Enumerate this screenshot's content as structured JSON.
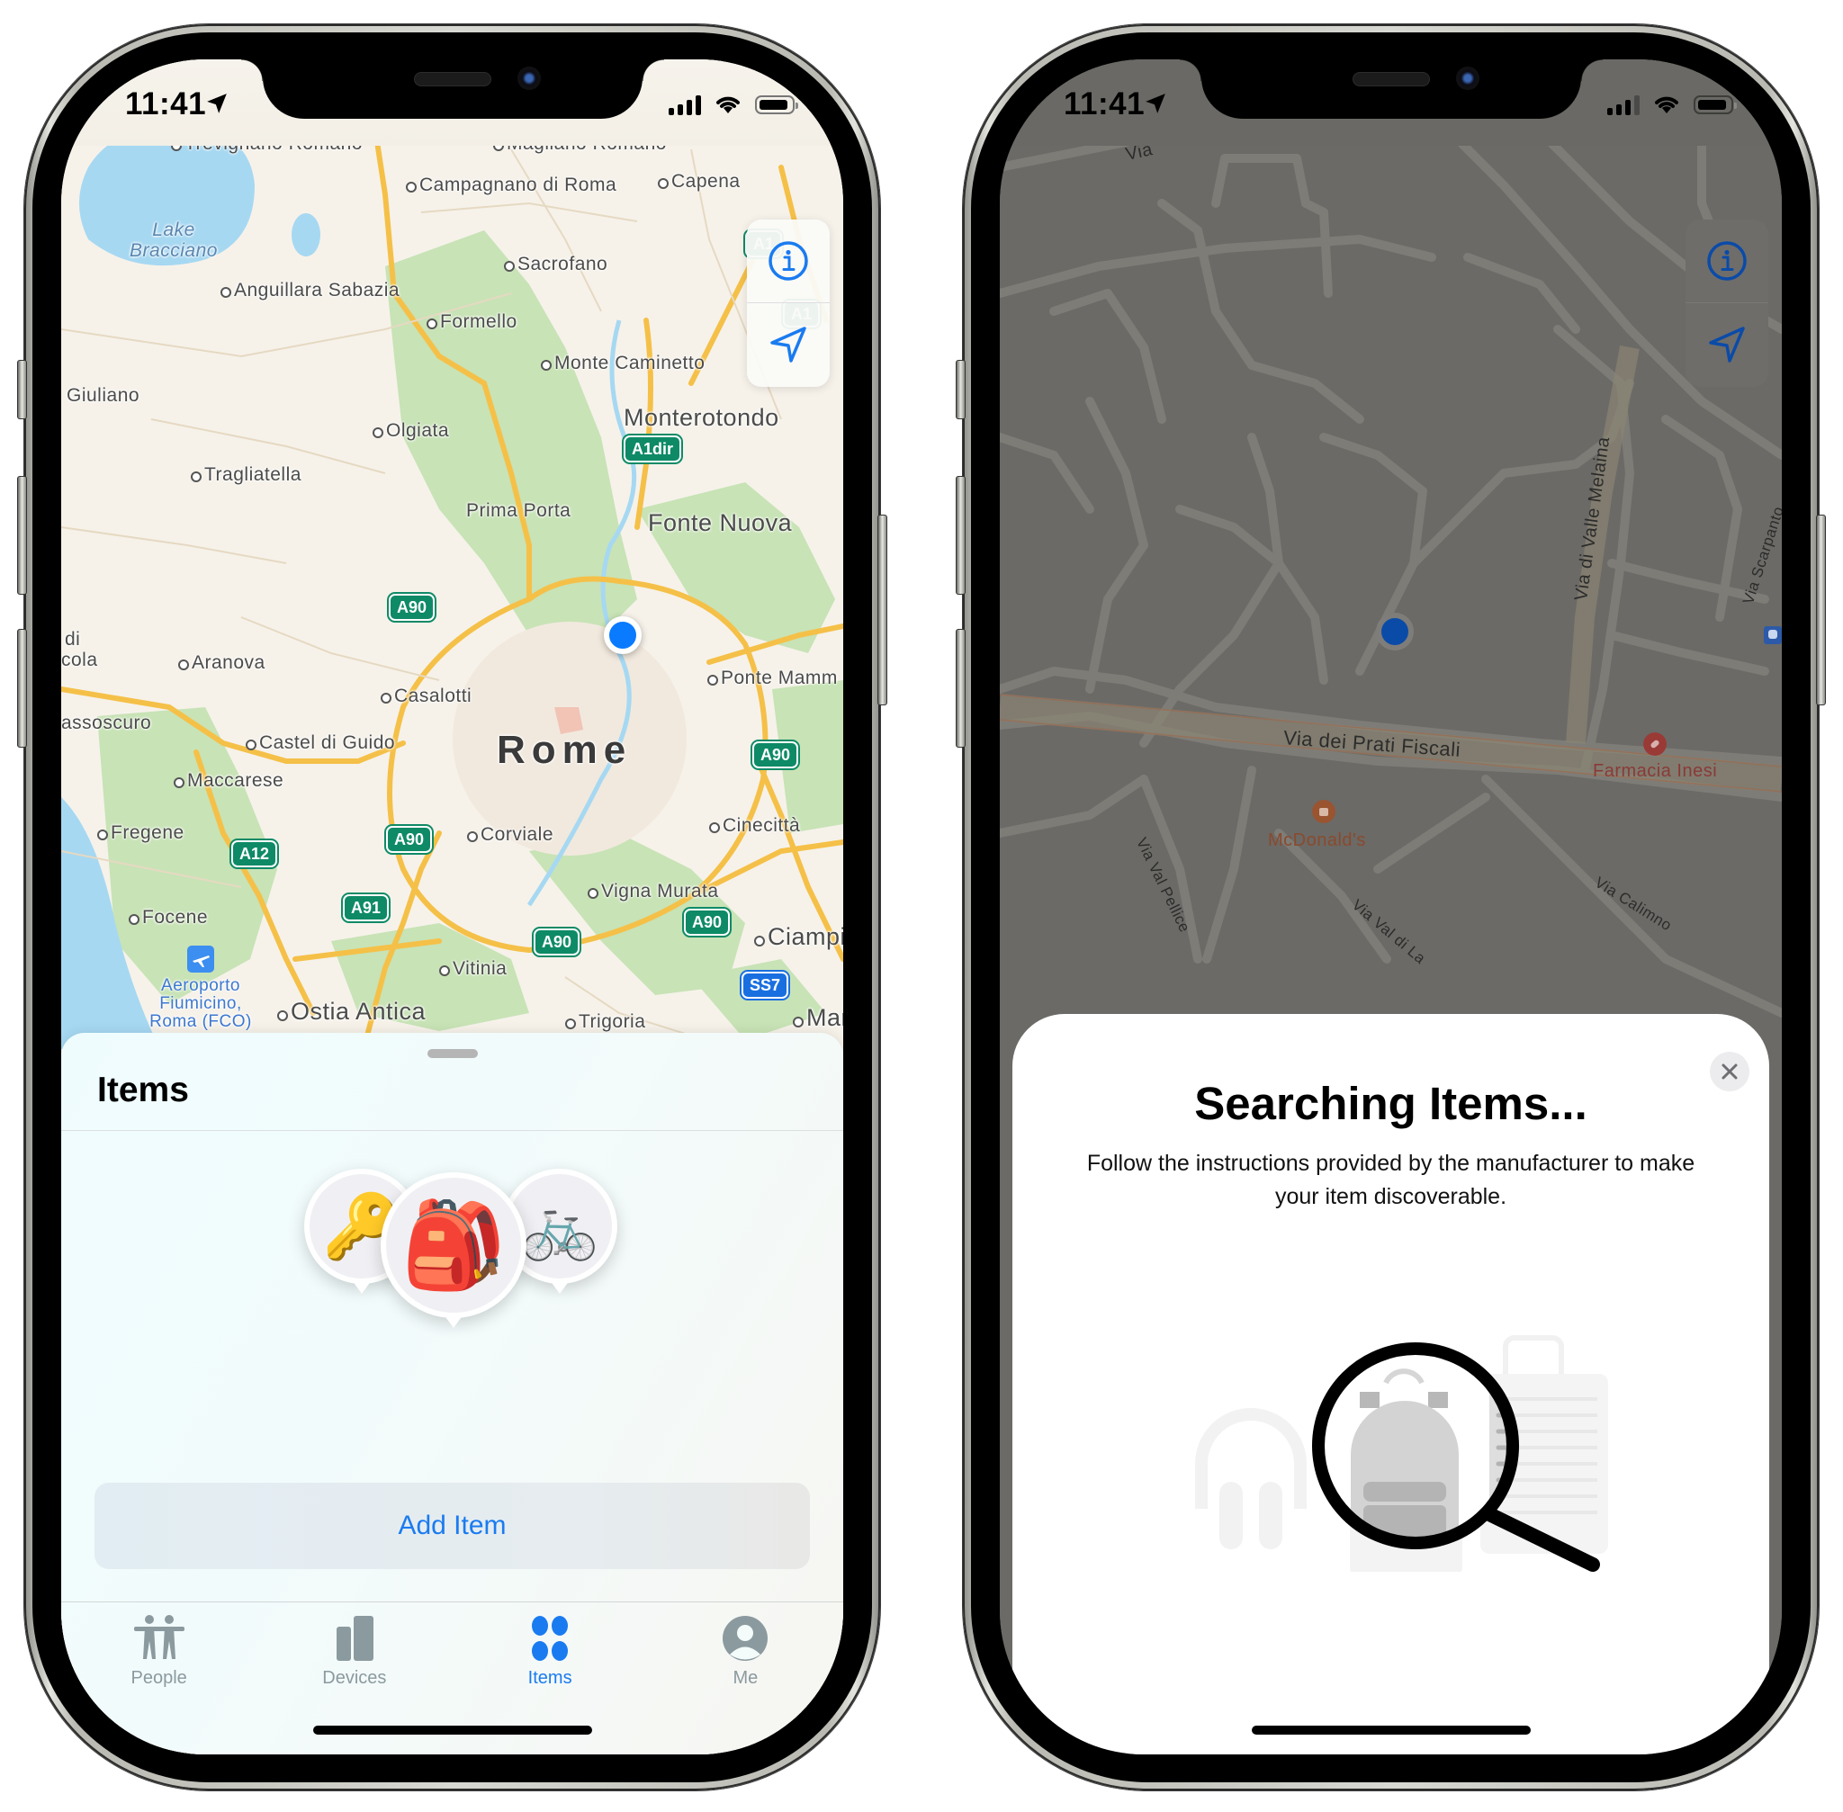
{
  "status_bar": {
    "time": "11:41"
  },
  "left_phone": {
    "map": {
      "labels": {
        "trevignano": "Trevignano Romano",
        "magliano": "Magliano Romano",
        "campagnano": "Campagnano di Roma",
        "capena": "Capena",
        "lake": "Lake Bracciano",
        "sacrofano": "Sacrofano",
        "anguillara": "Anguillara Sabazia",
        "formello": "Formello",
        "monte_caminetto": "Monte Caminetto",
        "giuliano": "Giuliano",
        "monterotondo": "Monterotondo",
        "olgiata": "Olgiata",
        "tragliatella": "Tragliatella",
        "prima_porta": "Prima Porta",
        "fonte_nuova": "Fonte Nuova",
        "di": "di",
        "cola": "cola",
        "aranova": "Aranova",
        "ponte_mammolo": "Ponte Mamm",
        "casalotti": "Casalotti",
        "passoscuro": "assoscuro",
        "castel_di_guido": "Castel di Guido",
        "rome": "Rome",
        "maccarese": "Maccarese",
        "fregene": "Fregene",
        "corviale": "Corviale",
        "cinecitta": "Cinecittà",
        "focene": "Focene",
        "vigna_murata": "Vigna Murata",
        "ciampino": "Ciampi",
        "vitinia": "Vitinia",
        "airport": "Aeroporto Fiumicino, Roma (FCO)",
        "ostia_antica": "Ostia Antica",
        "trigoria": "Trigoria",
        "marino": "Mar"
      },
      "shields": {
        "a1_top": "A1",
        "a1_right": "A1",
        "a1dir": "A1dir",
        "a90_1": "A90",
        "a90_2": "A90",
        "a90_3": "A90",
        "a90_4": "A90",
        "a90_5": "A90",
        "a12": "A12",
        "a91": "A91",
        "ss7": "SS7"
      }
    },
    "controls": {
      "info": "info-icon",
      "locate": "location-arrow-icon"
    },
    "sheet": {
      "title": "Items",
      "items": [
        {
          "name": "Keys",
          "emoji": "🔑"
        },
        {
          "name": "Backpack",
          "emoji": "🎒"
        },
        {
          "name": "Bicycle",
          "emoji": "🚲"
        }
      ],
      "add_button": "Add Item"
    },
    "tabs": [
      {
        "label": "People",
        "icon": "people-icon",
        "active": false
      },
      {
        "label": "Devices",
        "icon": "devices-icon",
        "active": false
      },
      {
        "label": "Items",
        "icon": "items-icon",
        "active": true
      },
      {
        "label": "Me",
        "icon": "person-circle-icon",
        "active": false
      }
    ]
  },
  "right_phone": {
    "map": {
      "labels": {
        "via_top": "Via",
        "via_dei_prati_fiscali": "Via dei Prati Fiscali",
        "via_di_valle_melaina": "Via di Valle Melaina",
        "via_scarpanto": "Via Scarpanto",
        "farmacia": "Farmacia Inesi",
        "mcdonalds": "McDonald's",
        "via_val_pellice": "Via Val Pellice",
        "via_val_di_la": "Via Val di La",
        "via_calimno": "Via Calimno"
      }
    },
    "sheet": {
      "title": "Searching Items...",
      "body": "Follow the instructions provided by the manufacturer to make your item discoverable.",
      "close": "close-icon"
    }
  },
  "colors": {
    "accent": "#1a7bf0",
    "tab_inactive": "#8b9a9f",
    "shield_green": "#0e8a66",
    "shield_blue": "#1a6fe0",
    "user_dot": "#0a7aff",
    "dim_overlay": "#6b6a66"
  }
}
